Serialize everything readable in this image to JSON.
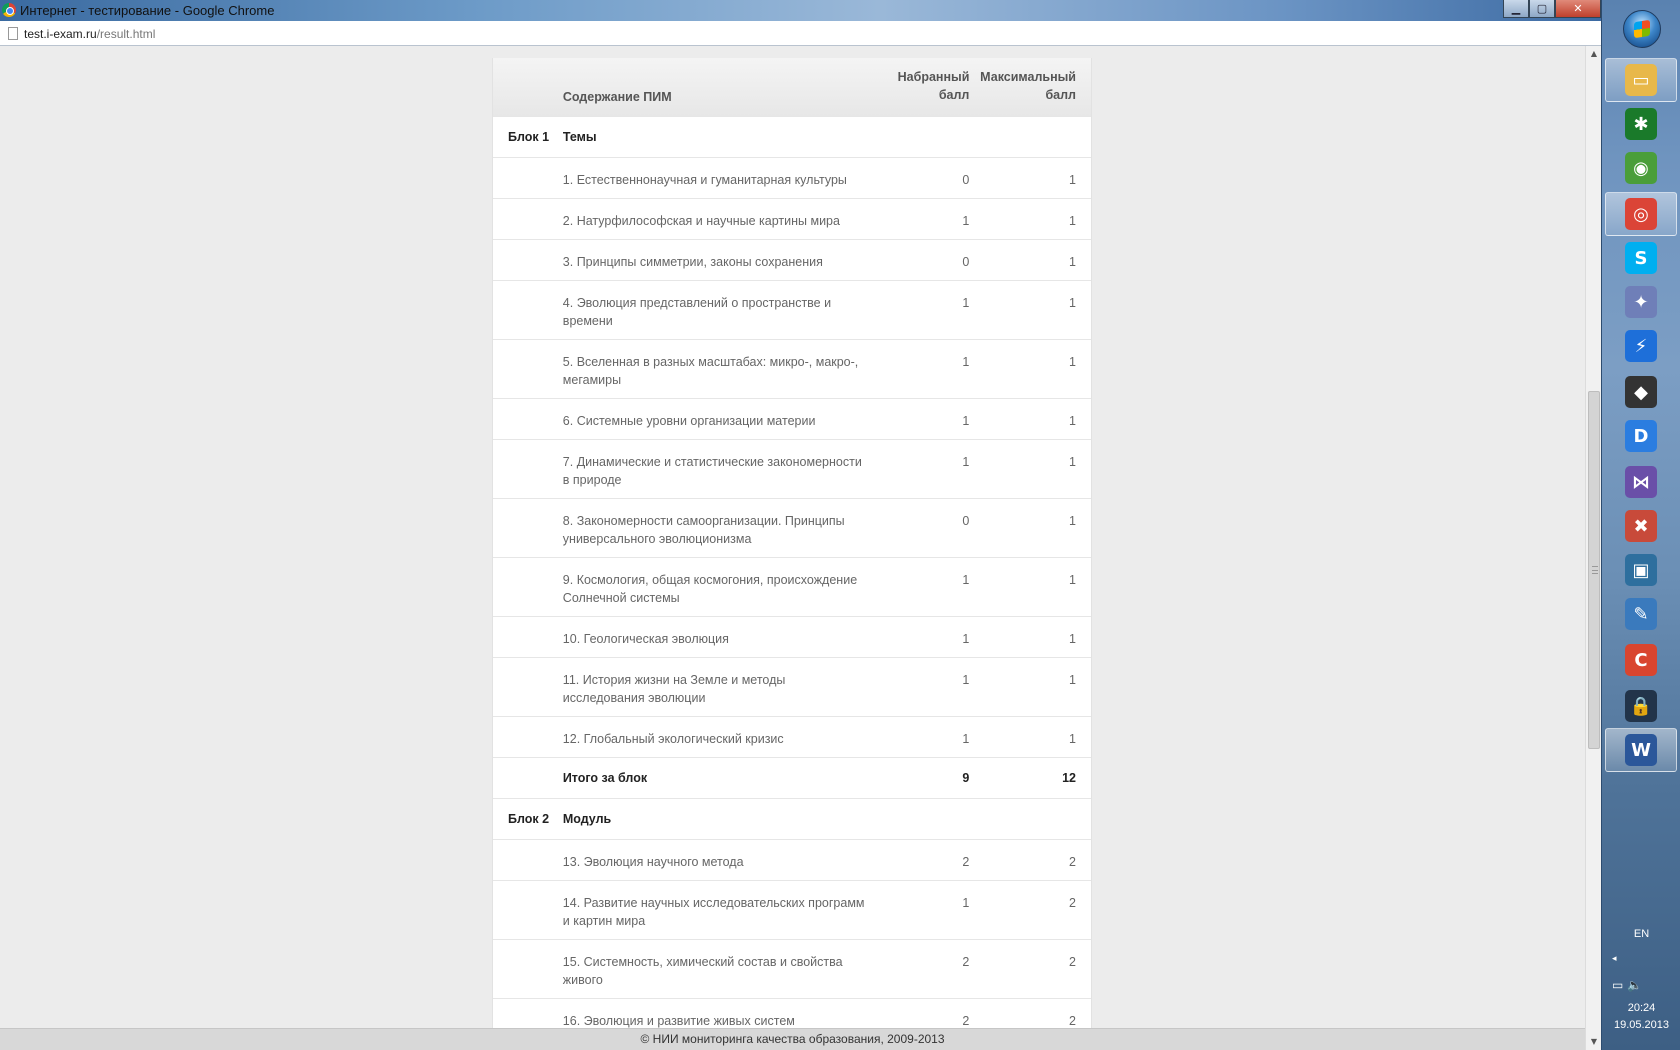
{
  "window": {
    "title": "Интернет - тестирование - Google Chrome",
    "min_glyph": "▁",
    "max_glyph": "▢",
    "close_glyph": "✕"
  },
  "address": {
    "host": "test.i-exam.ru",
    "path": "/result.html"
  },
  "table": {
    "headers": {
      "content": "Содержание ПИМ",
      "score_line1": "Набранный",
      "score_line2": "балл",
      "max_line1": "Максимальный",
      "max_line2": "балл"
    },
    "block1": {
      "label": "Блок 1",
      "title": "Темы",
      "items": [
        {
          "name": "1. Естественнонаучная и гуманитарная культуры",
          "score": "0",
          "max": "1"
        },
        {
          "name": "2. Натурфилософская и научные картины мира",
          "score": "1",
          "max": "1"
        },
        {
          "name": "3. Принципы симметрии, законы сохранения",
          "score": "0",
          "max": "1"
        },
        {
          "name": "4. Эволюция представлений о пространстве и времени",
          "score": "1",
          "max": "1"
        },
        {
          "name": "5. Вселенная в разных масштабах: микро-, макро-, мегамиры",
          "score": "1",
          "max": "1"
        },
        {
          "name": "6. Системные уровни организации материи",
          "score": "1",
          "max": "1"
        },
        {
          "name": "7. Динамические и статистические закономерности в природе",
          "score": "1",
          "max": "1"
        },
        {
          "name": "8. Закономерности самоорганизации. Принципы универсального эволюционизма",
          "score": "0",
          "max": "1"
        },
        {
          "name": "9. Космология, общая космогония, происхождение Солнечной системы",
          "score": "1",
          "max": "1"
        },
        {
          "name": "10. Геологическая эволюция",
          "score": "1",
          "max": "1"
        },
        {
          "name": "11. История жизни на Земле и методы исследования эволюции",
          "score": "1",
          "max": "1"
        },
        {
          "name": "12. Глобальный экологический кризис",
          "score": "1",
          "max": "1"
        }
      ],
      "total_label": "Итого за блок",
      "total_score": "9",
      "total_max": "12"
    },
    "block2": {
      "label": "Блок 2",
      "title": "Модуль",
      "items": [
        {
          "name": "13. Эволюция научного метода",
          "score": "2",
          "max": "2"
        },
        {
          "name": "14. Развитие научных исследовательских программ и картин мира",
          "score": "1",
          "max": "2"
        },
        {
          "name": "15. Системность, химический состав и свойства живого",
          "score": "2",
          "max": "2"
        },
        {
          "name": "16. Эволюция и развитие живых систем",
          "score": "2",
          "max": "2"
        }
      ]
    }
  },
  "footer": {
    "text": "© НИИ мониторинга качества образования, 2009-2013"
  },
  "scrollbar": {
    "up_glyph": "▲",
    "down_glyph": "▼"
  },
  "taskbar": {
    "items": [
      {
        "icon": "explorer-icon",
        "glyph": "▭",
        "color": "#e8b84a"
      },
      {
        "icon": "terminal-icon",
        "glyph": "✱",
        "color": "#1a7a2a"
      },
      {
        "icon": "network-icon",
        "glyph": "◉",
        "color": "#4a9e3a"
      },
      {
        "icon": "chrome-icon",
        "glyph": "◎",
        "color": "#db4437"
      },
      {
        "icon": "skype-icon",
        "glyph": "S",
        "color": "#00aff0"
      },
      {
        "icon": "media-icon",
        "glyph": "✦",
        "color": "#6f7fb8"
      },
      {
        "icon": "flash-icon",
        "glyph": "⚡",
        "color": "#1e6fd9"
      },
      {
        "icon": "foxit-icon",
        "glyph": "◆",
        "color": "#333333"
      },
      {
        "icon": "daemon-icon",
        "glyph": "D",
        "color": "#2b7de0"
      },
      {
        "icon": "visual-studio-icon",
        "glyph": "⋈",
        "color": "#6a4fa8"
      },
      {
        "icon": "tools-icon",
        "glyph": "✖",
        "color": "#c84a3a"
      },
      {
        "icon": "monitor-icon",
        "glyph": "▣",
        "color": "#2e6f9e"
      },
      {
        "icon": "settings-icon",
        "glyph": "✎",
        "color": "#3a7abd"
      },
      {
        "icon": "ccleaner-icon",
        "glyph": "C",
        "color": "#d9452f"
      },
      {
        "icon": "lock-icon",
        "glyph": "🔒",
        "color": "#22344a"
      },
      {
        "icon": "word-icon",
        "glyph": "W",
        "color": "#2b579a"
      }
    ],
    "lang": "EN",
    "tray_arrow": "◂",
    "tray_icons": "▭ 🔈",
    "time": "20:24",
    "date": "19.05.2013"
  }
}
